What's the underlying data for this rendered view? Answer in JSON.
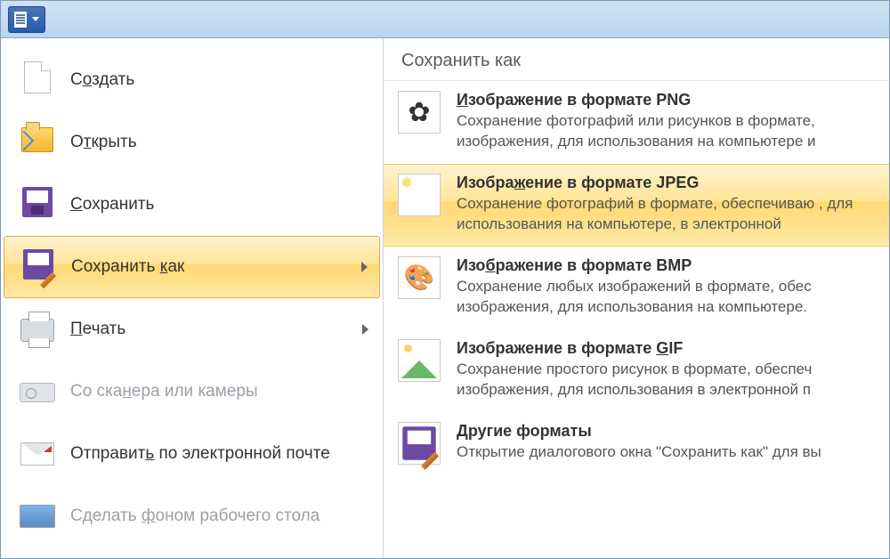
{
  "menu": {
    "items": [
      {
        "id": "new",
        "label_pre": "С",
        "label_ul": "о",
        "label_post": "здать"
      },
      {
        "id": "open",
        "label_pre": "О",
        "label_ul": "т",
        "label_post": "крыть"
      },
      {
        "id": "save",
        "label_pre": "",
        "label_ul": "С",
        "label_post": "охранить"
      },
      {
        "id": "saveas",
        "label_pre": "Сохранить ",
        "label_ul": "к",
        "label_post": "ак"
      },
      {
        "id": "print",
        "label_pre": "",
        "label_ul": "П",
        "label_post": "ечать"
      },
      {
        "id": "scanner",
        "label_pre": "Со ска",
        "label_ul": "н",
        "label_post": "ера или камеры"
      },
      {
        "id": "email",
        "label_pre": "Отправит",
        "label_ul": "ь",
        "label_post": " по электронной почте"
      },
      {
        "id": "desktop",
        "label_pre": "Сделать ",
        "label_ul": "ф",
        "label_post": "оном рабочего стола"
      }
    ]
  },
  "rightHeader": "Сохранить как",
  "formats": [
    {
      "id": "png",
      "title_pre": "",
      "title_ul": "И",
      "title_post": "зображение в формате PNG",
      "desc": "Сохранение фотографий или рисунков в формате, изображения, для использования на компьютере и"
    },
    {
      "id": "jpeg",
      "title_pre": "Изобра",
      "title_ul": "ж",
      "title_post": "ение в формате JPEG",
      "desc": "Сохранение фотографий в формате, обеспечиваю , для использования на компьютере, в электронной"
    },
    {
      "id": "bmp",
      "title_pre": "Изо",
      "title_ul": "б",
      "title_post": "ражение в формате BMP",
      "desc": "Сохранение любых изображений в формате, обес изображения, для использования на компьютере."
    },
    {
      "id": "gif",
      "title_pre": "Изображение в формате ",
      "title_ul": "G",
      "title_post": "IF",
      "desc": "Сохранение простого рисунок в формате, обеспеч изображения, для использования в электронной п"
    },
    {
      "id": "other",
      "title_pre": "",
      "title_ul": "Д",
      "title_post": "ругие форматы",
      "desc": "Открытие диалогового окна \"Сохранить как\" для вы"
    }
  ]
}
